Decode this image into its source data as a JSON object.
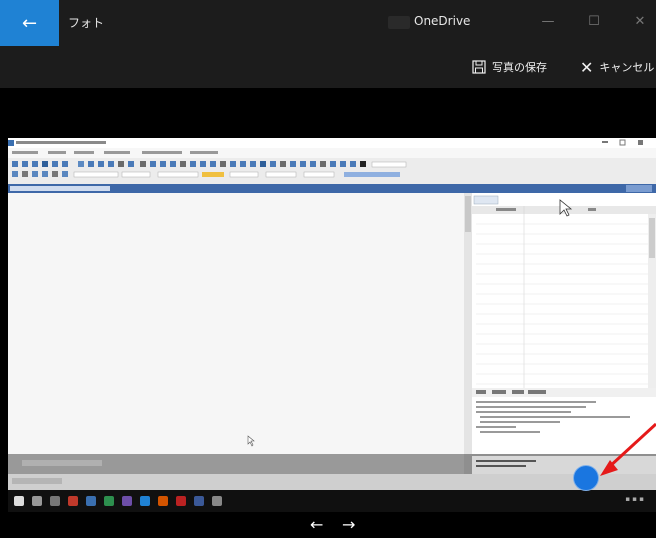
{
  "titlebar": {
    "app_title": "フォト",
    "center_label": "OneDrive",
    "minimize": "—",
    "maximize": "☐",
    "close": "✕"
  },
  "commandbar": {
    "save_label": "写真の保存",
    "cancel_label": "キャンセル"
  },
  "nav": {
    "prev": "←",
    "next": "→"
  },
  "colors": {
    "accent": "#1f82d4",
    "annotation_arrow": "#e51a1a",
    "annotation_dot": "#1a76e0"
  }
}
